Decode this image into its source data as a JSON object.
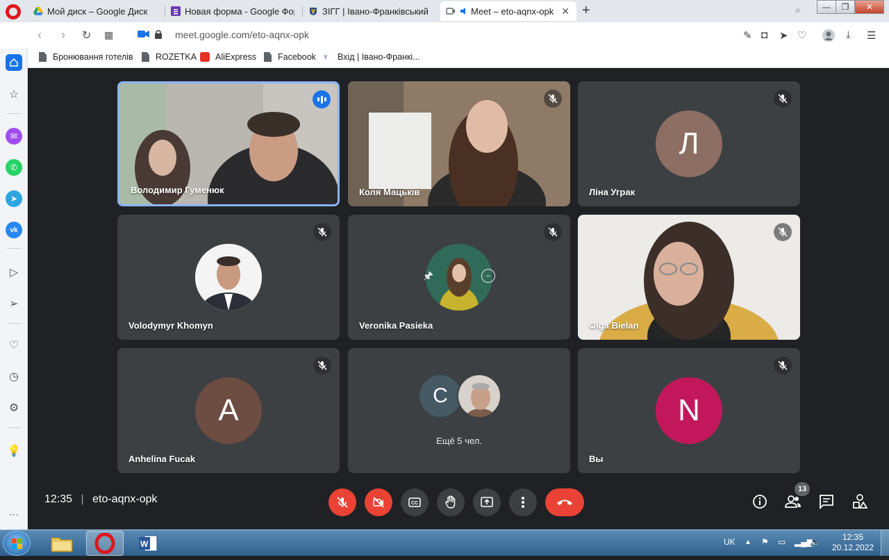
{
  "tabs": [
    {
      "title": "Мой диск – Google Диск",
      "icon": "google-drive-icon",
      "color": "#1fa463"
    },
    {
      "title": "Новая форма - Google Формы",
      "icon": "google-forms-icon",
      "color": "#673ab7"
    },
    {
      "title": "ЗІГГ | Івано-Франківський",
      "icon": "crest-icon",
      "color": "#2a4c8f"
    },
    {
      "title": "Meet – eto-aqnx-opk",
      "icon": "meet-icon",
      "color": "#1a73e8",
      "active": true
    }
  ],
  "address": {
    "url": "meet.google.com/eto-aqnx-opk"
  },
  "bookmarks": [
    {
      "label": "Бронювання готелів",
      "icon": "page-icon"
    },
    {
      "label": "ROZETKA",
      "icon": "page-icon"
    },
    {
      "label": "AliExpress",
      "icon": "aliexpress-icon"
    },
    {
      "label": "Facebook",
      "icon": "page-icon"
    },
    {
      "label": "Вхід | Івано-Франкі...",
      "icon": "crest-icon"
    }
  ],
  "participants": [
    {
      "name": "Володимир Гуменюк",
      "type": "video",
      "speaking": true
    },
    {
      "name": "Коля Мацьків",
      "type": "video",
      "muted": true
    },
    {
      "name": "Ліна Уграк",
      "type": "avatar",
      "initial": "Л",
      "color": "#8d6e63",
      "muted": true
    },
    {
      "name": "Volodymyr Khomyn",
      "type": "photo",
      "muted": true
    },
    {
      "name": "Veronika Pasieka",
      "type": "photo",
      "muted": true
    },
    {
      "name": "Olga Bielan",
      "type": "video",
      "muted": true
    },
    {
      "name": "Anhelina Fucak",
      "type": "avatar",
      "initial": "A",
      "color": "#6d4c41",
      "muted": true
    },
    {
      "name": "Ещё 5 чел.",
      "type": "group",
      "initial": "C",
      "color": "#455a64"
    },
    {
      "name": "Вы",
      "type": "avatar",
      "initial": "N",
      "color": "#c2185b",
      "muted": true
    }
  ],
  "meeting": {
    "time": "12:35",
    "code": "eto-aqnx-opk",
    "participant_count": "13"
  },
  "taskbar": {
    "lang": "UK",
    "time": "12:35",
    "date": "20.12.2022"
  },
  "colors": {
    "meet_bg": "#202124",
    "tile_bg": "#3c4043",
    "danger": "#ea4335",
    "accent": "#8ab4f8"
  }
}
